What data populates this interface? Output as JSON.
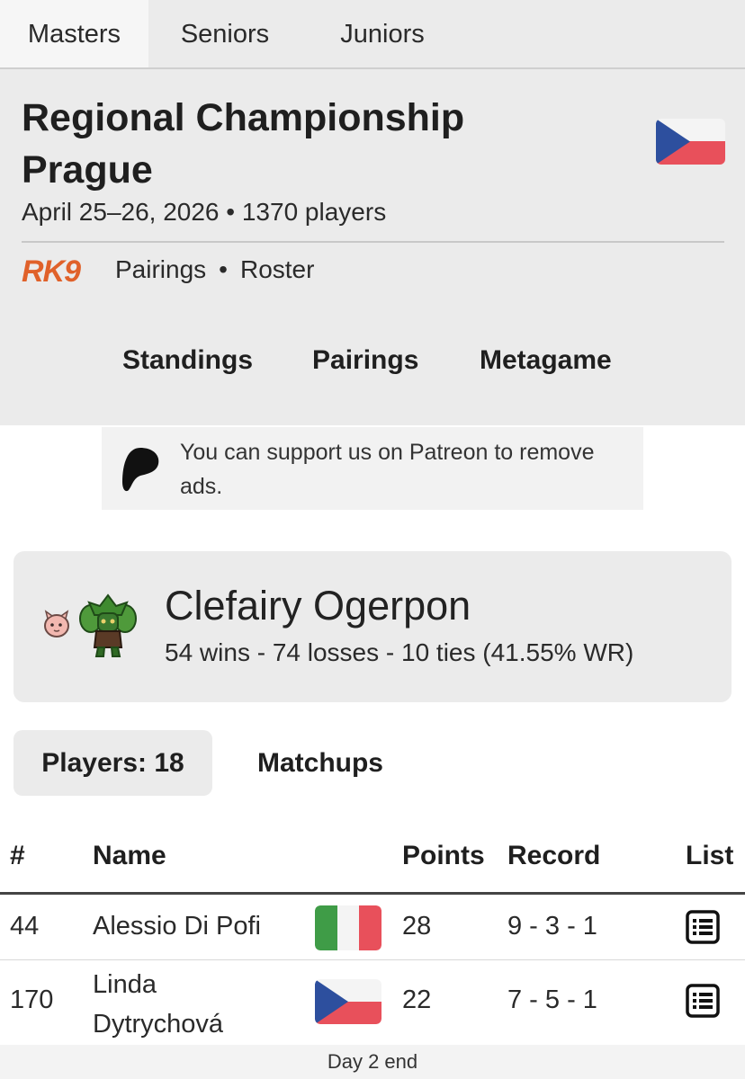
{
  "tabs": [
    "Masters",
    "Seniors",
    "Juniors"
  ],
  "event": {
    "title_line1": "Regional Championship",
    "title_line2": "Prague",
    "dates": "April 25–26, 2026 • 1370 players",
    "organizer_logo": "RK9",
    "links": [
      "Pairings",
      "Roster"
    ],
    "link_separator": "•"
  },
  "nav": [
    "Standings",
    "Pairings",
    "Metagame"
  ],
  "patreon": {
    "icon": "patreon-icon",
    "text": "You can support us on Patreon to remove ads."
  },
  "deck": {
    "name": "Clefairy Ogerpon",
    "record": "54 wins - 74 losses - 10 ties (41.55% WR)",
    "icons": [
      "clefairy-sprite-icon",
      "ogerpon-sprite-icon"
    ]
  },
  "subtabs": {
    "players": "Players: 18",
    "matchups": "Matchups"
  },
  "table": {
    "headers": {
      "rank": "#",
      "name": "Name",
      "points": "Points",
      "record": "Record",
      "list": "List"
    },
    "rows": [
      {
        "rank": "44",
        "name": "Alessio Di Pofi",
        "country": "italy-flag",
        "points": "28",
        "record": "9 - 3 - 1"
      },
      {
        "rank": "170",
        "name_line1": "Linda",
        "name_line2": "Dytrychová",
        "country": "czech-flag",
        "points": "22",
        "record": "7 - 5 - 1"
      }
    ]
  },
  "footer": "Day 2 end",
  "colors": {
    "panel": "#ebebeb",
    "rk9_orange": "#e0612a",
    "czech_blue": "#2d4f9e",
    "czech_red": "#e8505b",
    "italy_green": "#3f9c47",
    "italy_red": "#e8505b"
  }
}
